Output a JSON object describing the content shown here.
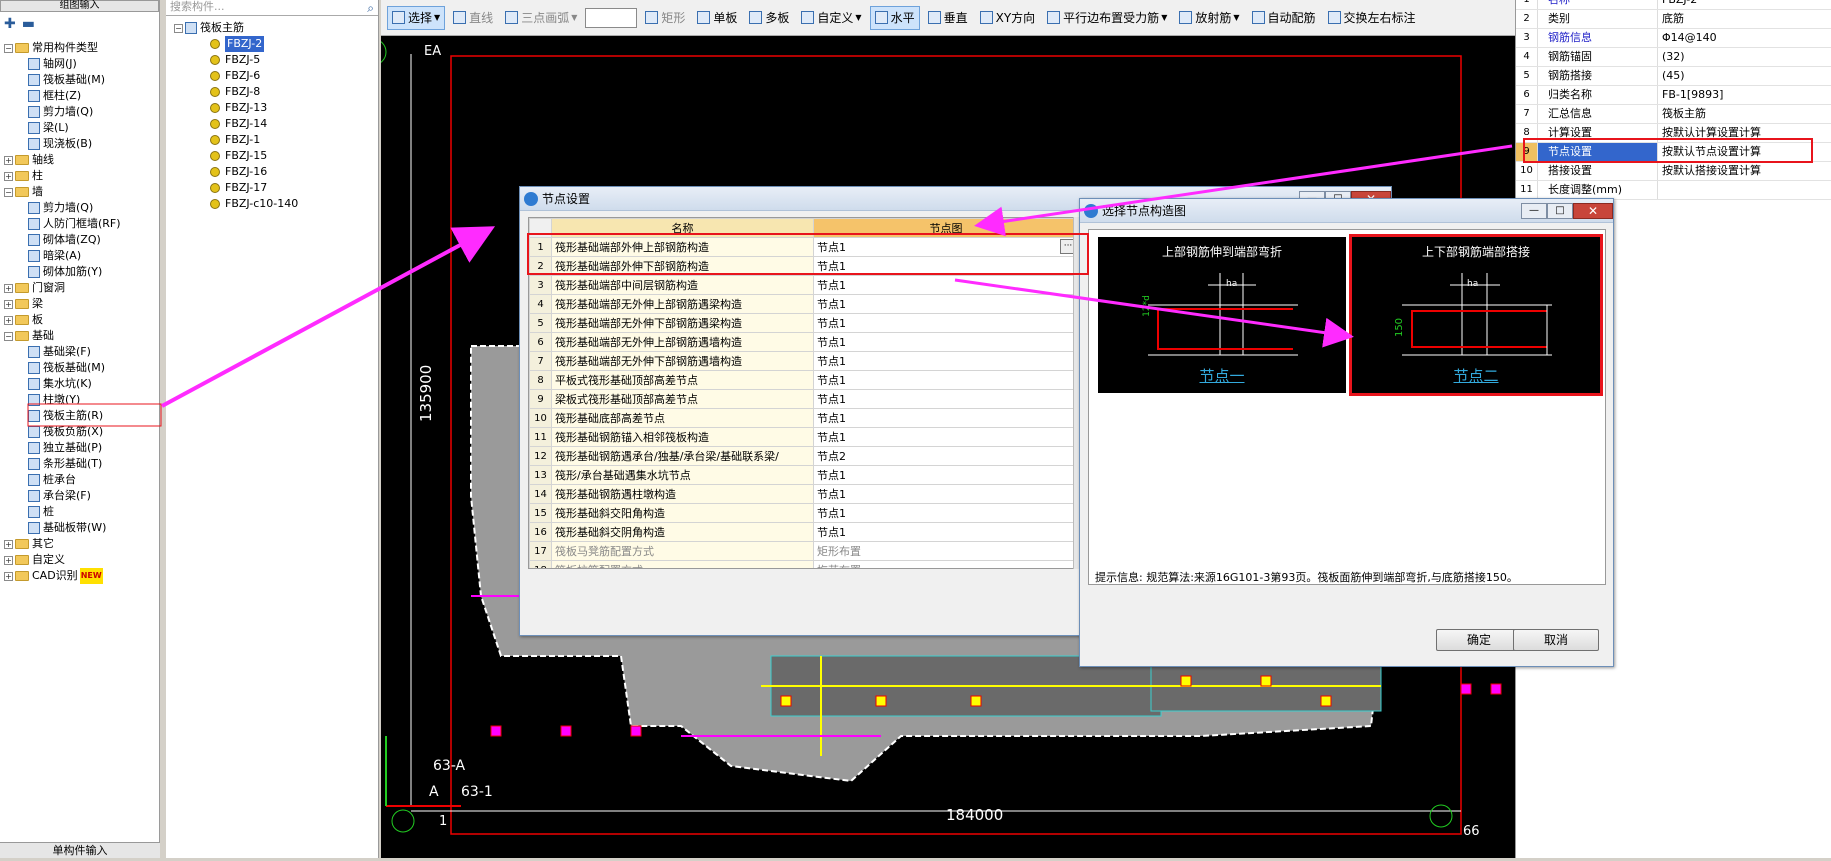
{
  "left_panel": {
    "title": "组图输入",
    "bottom_label": "单构件输入",
    "tree": [
      {
        "label": "常用构件类型",
        "type": "folder",
        "level": 0,
        "expanded": true
      },
      {
        "label": "轴网(J)",
        "type": "item",
        "level": 1
      },
      {
        "label": "筏板基础(M)",
        "type": "item",
        "level": 1
      },
      {
        "label": "框柱(Z)",
        "type": "item",
        "level": 1
      },
      {
        "label": "剪力墙(Q)",
        "type": "item",
        "level": 1
      },
      {
        "label": "梁(L)",
        "type": "item",
        "level": 1
      },
      {
        "label": "现浇板(B)",
        "type": "item",
        "level": 1
      },
      {
        "label": "轴线",
        "type": "folder",
        "level": 0,
        "expanded": false
      },
      {
        "label": "柱",
        "type": "folder",
        "level": 0,
        "expanded": false
      },
      {
        "label": "墙",
        "type": "folder",
        "level": 0,
        "expanded": true
      },
      {
        "label": "剪力墙(Q)",
        "type": "item",
        "level": 1
      },
      {
        "label": "人防门框墙(RF)",
        "type": "item",
        "level": 1
      },
      {
        "label": "砌体墙(ZQ)",
        "type": "item",
        "level": 1
      },
      {
        "label": "暗梁(A)",
        "type": "item",
        "level": 1
      },
      {
        "label": "砌体加筋(Y)",
        "type": "item",
        "level": 1
      },
      {
        "label": "门窗洞",
        "type": "folder",
        "level": 0,
        "expanded": false
      },
      {
        "label": "梁",
        "type": "folder",
        "level": 0,
        "expanded": false
      },
      {
        "label": "板",
        "type": "folder",
        "level": 0,
        "expanded": false
      },
      {
        "label": "基础",
        "type": "folder",
        "level": 0,
        "expanded": true
      },
      {
        "label": "基础梁(F)",
        "type": "item",
        "level": 1
      },
      {
        "label": "筏板基础(M)",
        "type": "item",
        "level": 1
      },
      {
        "label": "集水坑(K)",
        "type": "item",
        "level": 1
      },
      {
        "label": "柱墩(Y)",
        "type": "item",
        "level": 1
      },
      {
        "label": "筏板主筋(R)",
        "type": "item",
        "level": 1,
        "highlight": true
      },
      {
        "label": "筏板负筋(X)",
        "type": "item",
        "level": 1
      },
      {
        "label": "独立基础(P)",
        "type": "item",
        "level": 1
      },
      {
        "label": "条形基础(T)",
        "type": "item",
        "level": 1
      },
      {
        "label": "桩承台",
        "type": "item",
        "level": 1
      },
      {
        "label": "承台梁(F)",
        "type": "item",
        "level": 1
      },
      {
        "label": "桩",
        "type": "item",
        "level": 1
      },
      {
        "label": "基础板带(W)",
        "type": "item",
        "level": 1
      },
      {
        "label": "其它",
        "type": "folder",
        "level": 0,
        "expanded": false
      },
      {
        "label": "自定义",
        "type": "folder",
        "level": 0,
        "expanded": false
      },
      {
        "label": "CAD识别",
        "type": "folder",
        "level": 0,
        "expanded": false,
        "badge": "NEW"
      }
    ]
  },
  "mid_panel": {
    "search_placeholder": "搜索构件...",
    "root": "筏板主筋",
    "items": [
      "FBZJ-2",
      "FBZJ-5",
      "FBZJ-6",
      "FBZJ-8",
      "FBZJ-13",
      "FBZJ-14",
      "FBZJ-1",
      "FBZJ-15",
      "FBZJ-16",
      "FBZJ-17",
      "FBZJ-c10-140"
    ],
    "selected": "FBZJ-2"
  },
  "toolbar": [
    {
      "label": "选择",
      "selected": true,
      "dropdown": true
    },
    {
      "label": "直线",
      "gray": true
    },
    {
      "label": "三点画弧",
      "gray": true,
      "dropdown": true
    },
    {
      "label": "",
      "combo": true
    },
    {
      "label": "矩形",
      "gray": true
    },
    {
      "label": "单板"
    },
    {
      "label": "多板"
    },
    {
      "label": "自定义",
      "dropdown": true
    },
    {
      "label": "水平",
      "selected": true
    },
    {
      "label": "垂直"
    },
    {
      "label": "XY方向"
    },
    {
      "label": "平行边布置受力筋",
      "dropdown": true
    },
    {
      "label": "放射筋",
      "dropdown": true
    },
    {
      "label": "自动配筋"
    },
    {
      "label": "交换左右标注"
    }
  ],
  "canvas": {
    "axis_top_left": "EA",
    "dim_vertical": "135900",
    "dim_horizontal": "184000",
    "axis_bottom_left": "1",
    "axis_bottom_right": "66",
    "label_a": "63-A",
    "label_b": "63-1",
    "corner_a": "A"
  },
  "props": {
    "rows": [
      {
        "n": "1",
        "k": "名称",
        "v": "FBZJ-2",
        "blue": true
      },
      {
        "n": "2",
        "k": "类别",
        "v": "底筋"
      },
      {
        "n": "3",
        "k": "钢筋信息",
        "v": "Φ14@140",
        "blue": true
      },
      {
        "n": "4",
        "k": "钢筋锚固",
        "v": "(32)"
      },
      {
        "n": "5",
        "k": "钢筋搭接",
        "v": "(45)"
      },
      {
        "n": "6",
        "k": "归类名称",
        "v": "FB-1[9893]"
      },
      {
        "n": "7",
        "k": "汇总信息",
        "v": "筏板主筋"
      },
      {
        "n": "8",
        "k": "计算设置",
        "v": "按默认计算设置计算"
      },
      {
        "n": "9",
        "k": "节点设置",
        "v": "按默认节点设置计算",
        "selected": true
      },
      {
        "n": "10",
        "k": "搭接设置",
        "v": "按默认搭接设置计算"
      },
      {
        "n": "11",
        "k": "长度调整(mm)",
        "v": ""
      }
    ]
  },
  "node_dialog": {
    "title": "节点设置",
    "col_name": "名称",
    "col_value": "节点图",
    "rows": [
      {
        "n": "1",
        "name": "筏形基础端部外伸上部钢筋构造",
        "value": "节点1"
      },
      {
        "n": "2",
        "name": "筏形基础端部外伸下部钢筋构造",
        "value": "节点1"
      },
      {
        "n": "3",
        "name": "筏形基础端部中间层钢筋构造",
        "value": "节点1"
      },
      {
        "n": "4",
        "name": "筏形基础端部无外伸上部钢筋遇梁构造",
        "value": "节点1"
      },
      {
        "n": "5",
        "name": "筏形基础端部无外伸下部钢筋遇梁构造",
        "value": "节点1"
      },
      {
        "n": "6",
        "name": "筏形基础端部无外伸上部钢筋遇墙构造",
        "value": "节点1"
      },
      {
        "n": "7",
        "name": "筏形基础端部无外伸下部钢筋遇墙构造",
        "value": "节点1"
      },
      {
        "n": "8",
        "name": "平板式筏形基础顶部高差节点",
        "value": "节点1"
      },
      {
        "n": "9",
        "name": "梁板式筏形基础顶部高差节点",
        "value": "节点1"
      },
      {
        "n": "10",
        "name": "筏形基础底部高差节点",
        "value": "节点1"
      },
      {
        "n": "11",
        "name": "筏形基础钢筋锚入相邻筏板构造",
        "value": "节点1"
      },
      {
        "n": "12",
        "name": "筏形基础钢筋遇承台/独基/承台梁/基础联系梁/",
        "value": "节点2"
      },
      {
        "n": "13",
        "name": "筏形/承台基础遇集水坑节点",
        "value": "节点1"
      },
      {
        "n": "14",
        "name": "筏形基础钢筋遇柱墩构造",
        "value": "节点1"
      },
      {
        "n": "15",
        "name": "筏形基础斜交阳角构造",
        "value": "节点1"
      },
      {
        "n": "16",
        "name": "筏形基础斜交阴角构造",
        "value": "节点1"
      },
      {
        "n": "17",
        "name": "筏板马凳筋配置方式",
        "value": "矩形布置",
        "dim": true
      },
      {
        "n": "18",
        "name": "筏板拉筋配置方式",
        "value": "梅花布置",
        "dim": true
      }
    ]
  },
  "select_dialog": {
    "title": "选择节点构造图",
    "option1_title": "上部钢筋伸到端部弯折",
    "option1_caption": "节点一",
    "option2_title": "上下部钢筋端部搭接",
    "option2_caption": "节点二",
    "dim_left": "12*d",
    "dim_right": "150",
    "ha": "ha",
    "hint": "提示信息:  规范算法:来源16G101-3第93页。筏板面筋伸到端部弯折,与底筋搭接150。",
    "ok": "确定",
    "cancel": "取消"
  },
  "colors": {
    "accent_red": "#e8141c",
    "arrow_magenta": "#ff2bff",
    "header_orange": "#f7e6b0"
  }
}
